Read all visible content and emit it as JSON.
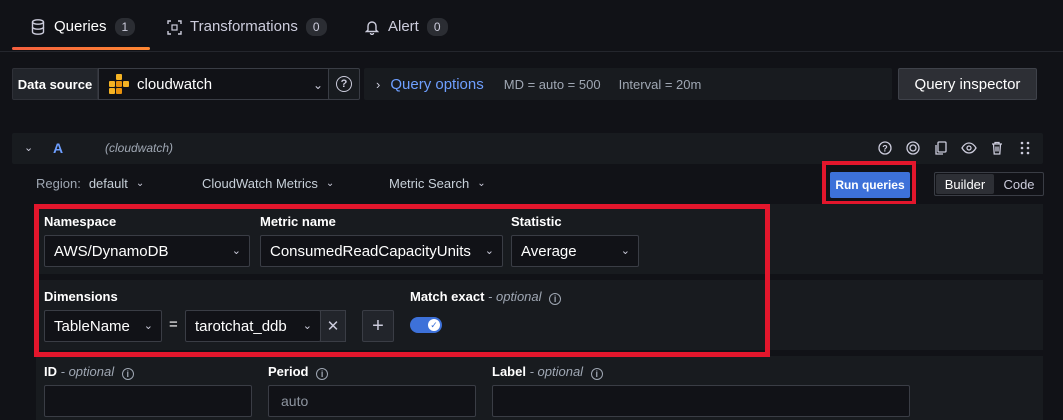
{
  "tabs": [
    {
      "label": "Queries",
      "count": "1",
      "icon": "database-icon"
    },
    {
      "label": "Transformations",
      "count": "0",
      "icon": "transform-icon"
    },
    {
      "label": "Alert",
      "count": "0",
      "icon": "bell-icon"
    }
  ],
  "datasource": {
    "label": "Data source",
    "selected": "cloudwatch",
    "icon": "aws-logo"
  },
  "query_options": {
    "title": "Query options",
    "md": "MD = auto = 500",
    "interval": "Interval = 20m"
  },
  "query_inspector_label": "Query inspector",
  "query": {
    "ref_id": "A",
    "datasource_name": "(cloudwatch)"
  },
  "editor": {
    "region_label": "Region:",
    "region_value": "default",
    "service": "CloudWatch Metrics",
    "mode": "Metric Search",
    "run_label": "Run queries",
    "builder_label": "Builder",
    "code_label": "Code"
  },
  "builder": {
    "namespace_label": "Namespace",
    "namespace_value": "AWS/DynamoDB",
    "metric_label": "Metric name",
    "metric_value": "ConsumedReadCapacityUnits",
    "statistic_label": "Statistic",
    "statistic_value": "Average",
    "dimensions_label": "Dimensions",
    "dim_key": "TableName",
    "dim_op": "=",
    "dim_value": "tarotchat_ddb",
    "match_exact_label": "Match exact",
    "optional_text": "- optional",
    "match_exact_on": true,
    "id_label": "ID",
    "period_label": "Period",
    "period_placeholder": "auto",
    "label_label": "Label"
  },
  "colors": {
    "accent": "#3d71d9",
    "highlight": "#e3162c",
    "tab_underline": "#f55f3e"
  }
}
